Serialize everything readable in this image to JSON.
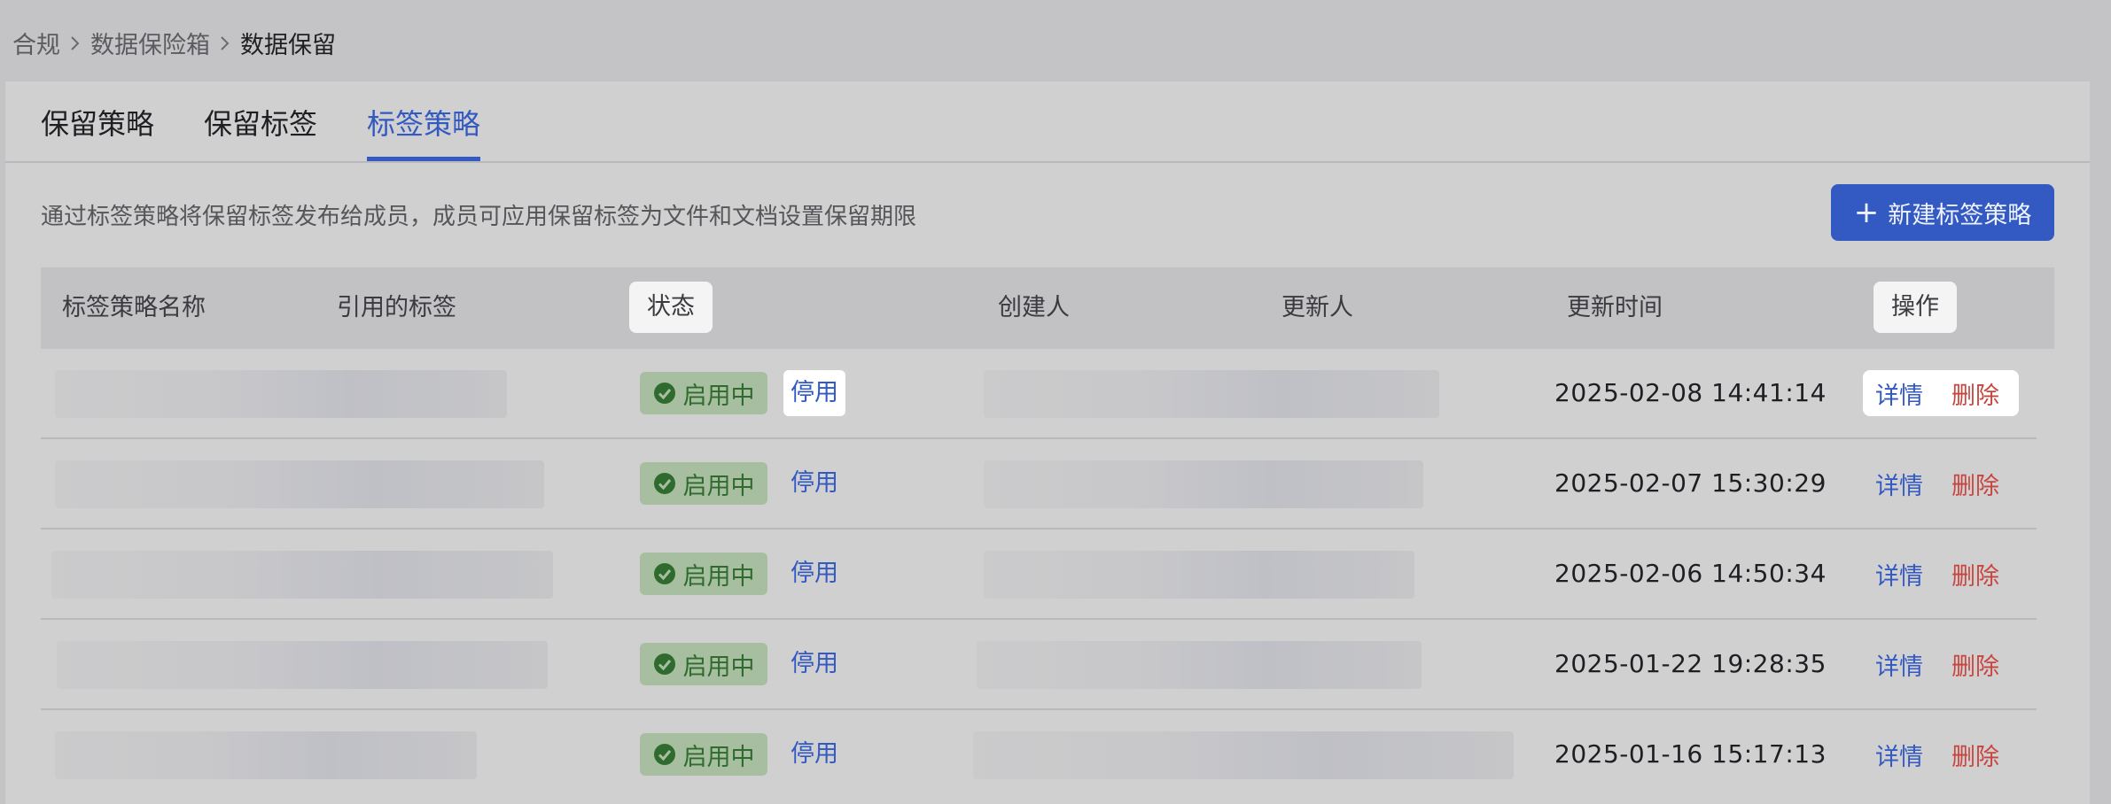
{
  "breadcrumb": {
    "items": [
      "合规",
      "数据保险箱",
      "数据保留"
    ]
  },
  "tabs": [
    {
      "label": "保留策略",
      "active": false
    },
    {
      "label": "保留标签",
      "active": false
    },
    {
      "label": "标签策略",
      "active": true
    }
  ],
  "description": "通过标签策略将保留标签发布给成员，成员可应用保留标签为文件和文档设置保留期限",
  "new_button": {
    "label": "新建标签策略",
    "icon": "plus-icon"
  },
  "table": {
    "columns": [
      "标签策略名称",
      "引用的标签",
      "状态",
      "创建人",
      "更新人",
      "更新时间",
      "操作"
    ],
    "rows": [
      {
        "status": "启用中",
        "toggle": "停用",
        "updated": "2025-02-08 14:41:14",
        "detail": "详情",
        "delete": "删除"
      },
      {
        "status": "启用中",
        "toggle": "停用",
        "updated": "2025-02-07 15:30:29",
        "detail": "详情",
        "delete": "删除"
      },
      {
        "status": "启用中",
        "toggle": "停用",
        "updated": "2025-02-06 14:50:34",
        "detail": "详情",
        "delete": "删除"
      },
      {
        "status": "启用中",
        "toggle": "停用",
        "updated": "2025-01-22 19:28:35",
        "detail": "详情",
        "delete": "删除"
      },
      {
        "status": "启用中",
        "toggle": "停用",
        "updated": "2025-01-16 15:17:13",
        "detail": "详情",
        "delete": "删除"
      }
    ]
  },
  "colors": {
    "accent": "#3359c2",
    "status_bg": "#a7bfa0",
    "status_text": "#2f6b2e",
    "danger": "#c8443e"
  }
}
